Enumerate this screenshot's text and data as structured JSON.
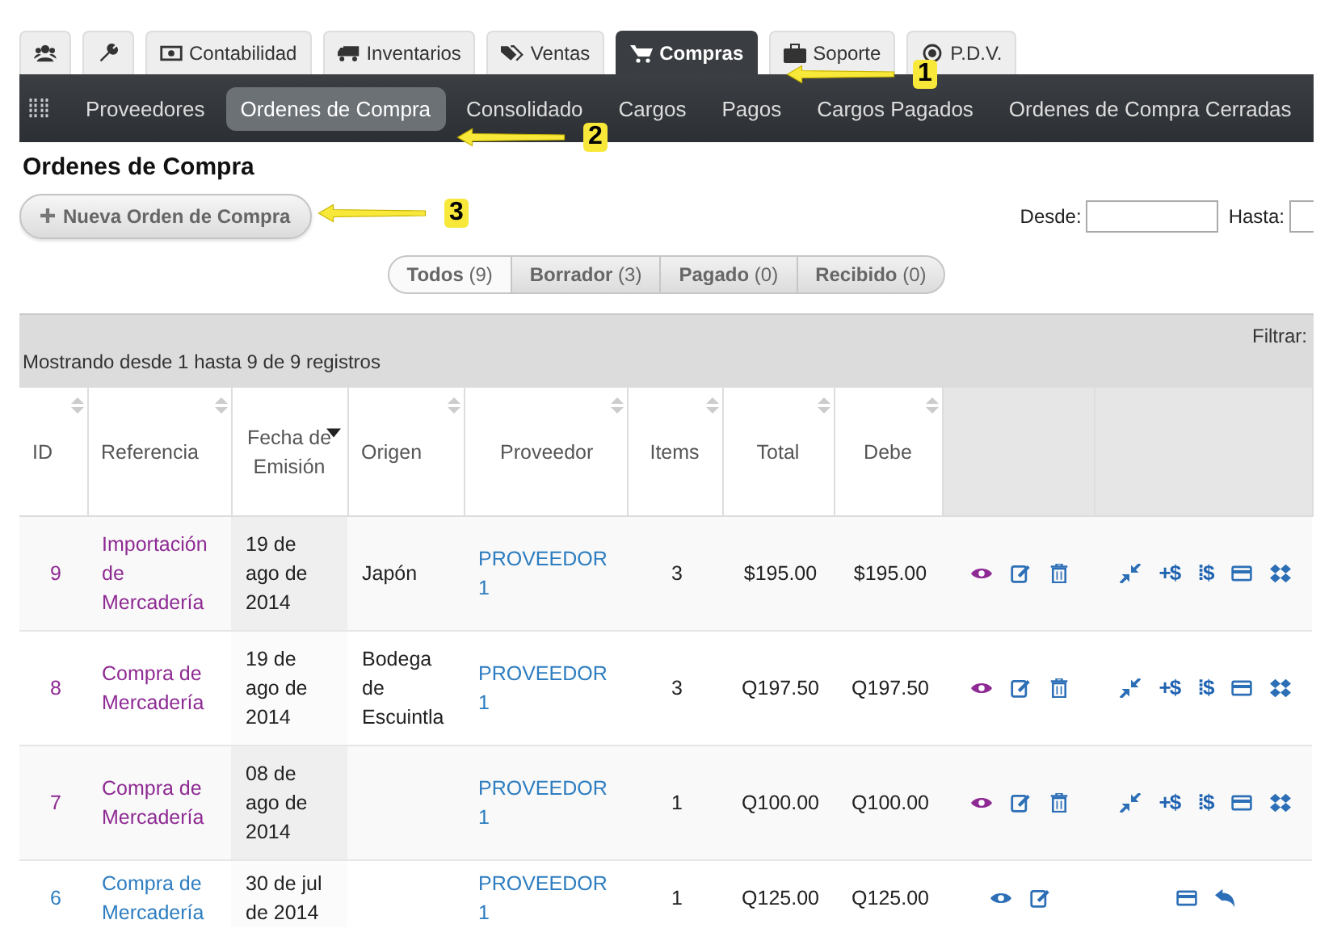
{
  "top_tabs": [
    {
      "kind": "users",
      "selected": false
    },
    {
      "kind": "wrench",
      "selected": false
    },
    {
      "kind": "money",
      "label": "Contabilidad",
      "selected": false
    },
    {
      "kind": "truck",
      "label": "Inventarios",
      "selected": false
    },
    {
      "kind": "tag",
      "label": "Ventas",
      "selected": false
    },
    {
      "kind": "cart",
      "label": "Compras",
      "selected": true
    },
    {
      "kind": "briefcase",
      "label": "Soporte",
      "selected": false
    },
    {
      "kind": "target",
      "label": "P.D.V.",
      "selected": false
    }
  ],
  "sub_nav": [
    {
      "label": "Proveedores",
      "selected": false
    },
    {
      "label": "Ordenes de Compra",
      "selected": true
    },
    {
      "label": "Consolidado",
      "selected": false
    },
    {
      "label": "Cargos",
      "selected": false
    },
    {
      "label": "Pagos",
      "selected": false
    },
    {
      "label": "Cargos Pagados",
      "selected": false
    },
    {
      "label": "Ordenes de Compra Cerradas",
      "selected": false
    }
  ],
  "page_title": "Ordenes de Compra",
  "new_button": "Nueva Orden de Compra",
  "date_filter": {
    "from_label": "Desde:",
    "to_label": "Hasta:"
  },
  "status_filters": [
    {
      "label": "Todos",
      "count": "(9)",
      "selected": true
    },
    {
      "label": "Borrador",
      "count": "(3)",
      "selected": false
    },
    {
      "label": "Pagado",
      "count": "(0)",
      "selected": false
    },
    {
      "label": "Recibido",
      "count": "(0)",
      "selected": false
    }
  ],
  "info": "Mostrando desde 1 hasta 9 de 9 registros",
  "filter_label": "Filtrar:",
  "table": {
    "columns": [
      {
        "label": "ID",
        "sorted": false
      },
      {
        "label": "Referencia",
        "sorted": false
      },
      {
        "label": "Fecha de Emisión",
        "sorted": true
      },
      {
        "label": "Origen",
        "sorted": false
      },
      {
        "label": "Proveedor",
        "sorted": false
      },
      {
        "label": "Items",
        "sorted": false
      },
      {
        "label": "Total",
        "sorted": false
      },
      {
        "label": "Debe",
        "sorted": false
      }
    ],
    "rows": [
      {
        "id": "9",
        "reference": "Importación de Mercadería",
        "date": "19 de ago de 2014",
        "origin": "Japón",
        "supplier": "PROVEEDOR 1",
        "items": "3",
        "total": "$195.00",
        "due": "$195.00",
        "visited": true,
        "kind": "full",
        "glyphs": [
          "+$",
          "⁞$"
        ]
      },
      {
        "id": "8",
        "reference": "Compra de Mercadería",
        "date": "19 de ago de 2014",
        "origin": "Bodega de Escuintla",
        "supplier": "PROVEEDOR 1",
        "items": "3",
        "total": "Q197.50",
        "due": "Q197.50",
        "visited": true,
        "kind": "full",
        "glyphs": [
          "+$",
          "⁞$"
        ]
      },
      {
        "id": "7",
        "reference": "Compra de Mercadería",
        "date": "08 de ago de 2014",
        "supplier": "PROVEEDOR 1",
        "items": "1",
        "total": "Q100.00",
        "due": "Q100.00",
        "visited": true,
        "kind": "full",
        "glyphs": [
          "+$",
          "⁞$"
        ]
      },
      {
        "id": "6",
        "reference": "Compra de Mercadería",
        "date": "30 de jul de 2014",
        "supplier": "PROVEEDOR 1",
        "items": "1",
        "total": "Q125.00",
        "due": "Q125.00",
        "visited": false,
        "kind": "short"
      }
    ]
  },
  "annotations": [
    {
      "number": "1"
    },
    {
      "number": "2"
    },
    {
      "number": "3"
    }
  ]
}
